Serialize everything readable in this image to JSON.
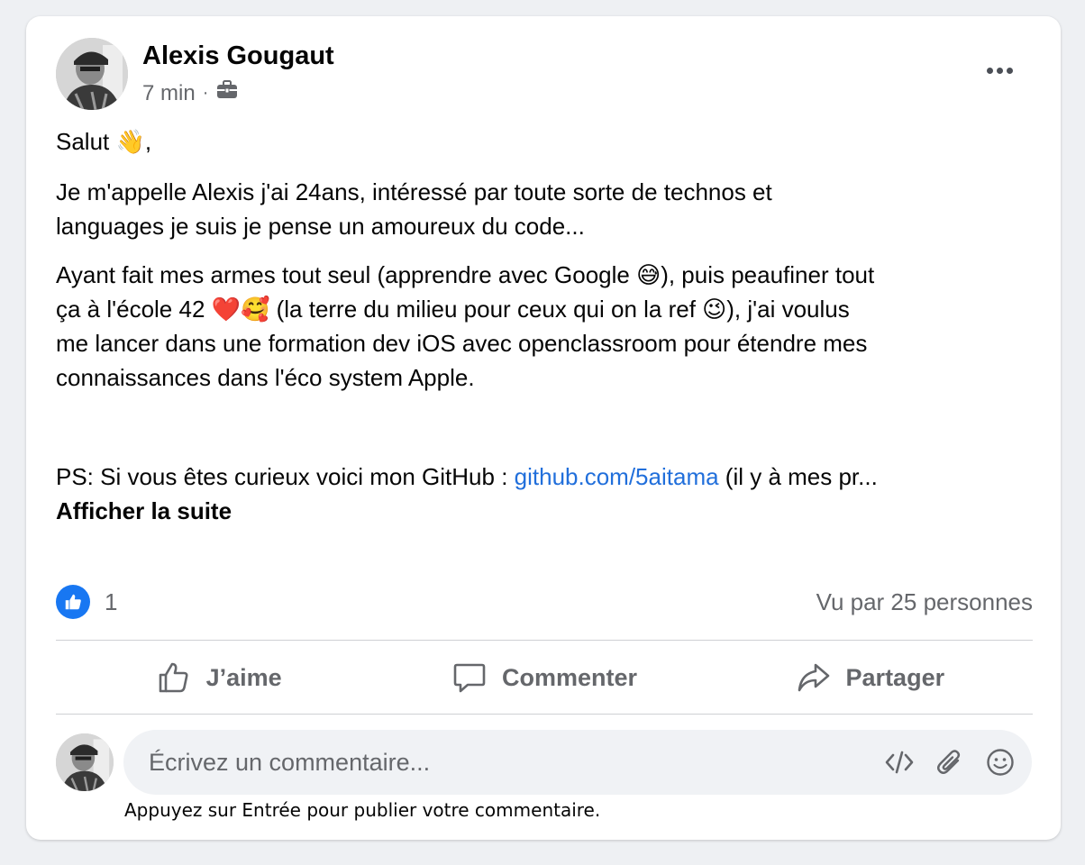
{
  "post": {
    "author_name": "Alexis Gougaut",
    "time": "7 min",
    "separator": "·",
    "audience_icon": "briefcase-icon",
    "greeting": "Salut 👋,",
    "paragraph1_line1": "Je m'appelle Alexis j'ai 24ans, intéressé par toute sorte de technos et",
    "paragraph1_line2": "languages je suis je pense un amoureux du code...",
    "paragraph2_line1": "Ayant fait mes armes tout seul (apprendre avec Google 😅), puis peaufiner tout",
    "paragraph2_line2": "ça à l'école 42 ❤️🥰 (la terre du milieu pour ceux qui on la ref 😉), j'ai voulus",
    "paragraph2_line3": "me lancer dans une formation dev iOS avec openclassroom pour étendre mes",
    "paragraph2_line4": "connaissances dans l'éco system Apple.",
    "ps_prefix": "PS: Si vous êtes curieux voici mon GitHub : ",
    "ps_link": "github.com/5aitama",
    "ps_suffix": " (il y à mes pr...",
    "see_more": "Afficher la suite"
  },
  "reactions": {
    "like_count": "1",
    "seen_by": "Vu par 25 personnes"
  },
  "actions": {
    "like": "J’aime",
    "comment": "Commenter",
    "share": "Partager"
  },
  "comment_box": {
    "placeholder": "Écrivez un commentaire...",
    "hint": "Appuyez sur Entrée pour publier votre commentaire."
  },
  "colors": {
    "link": "#216fdb",
    "like_badge": "#1877f2",
    "secondary_text": "#65676b"
  }
}
